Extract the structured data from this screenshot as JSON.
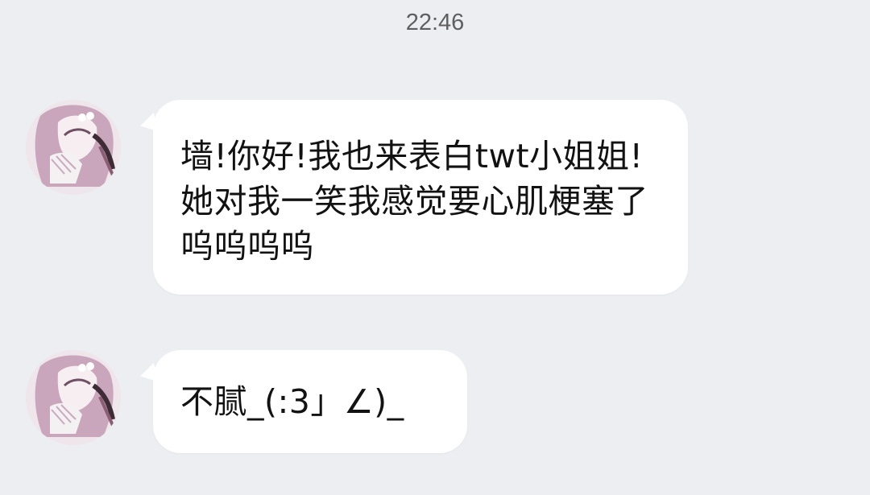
{
  "timestamp": "22:46",
  "messages": [
    {
      "sender_avatar": "anime-girl-avatar",
      "text": "墙!你好!我也来表白twt小姐姐!她对我一笑我感觉要心肌梗塞了呜呜呜呜"
    },
    {
      "sender_avatar": "anime-girl-avatar",
      "text": "不腻_(:3」∠)_"
    }
  ],
  "colors": {
    "background": "#eceef2",
    "bubble": "#ffffff",
    "text": "#121212",
    "timestamp": "#5f5f5f",
    "avatar_hair": "#c9a6bc"
  }
}
